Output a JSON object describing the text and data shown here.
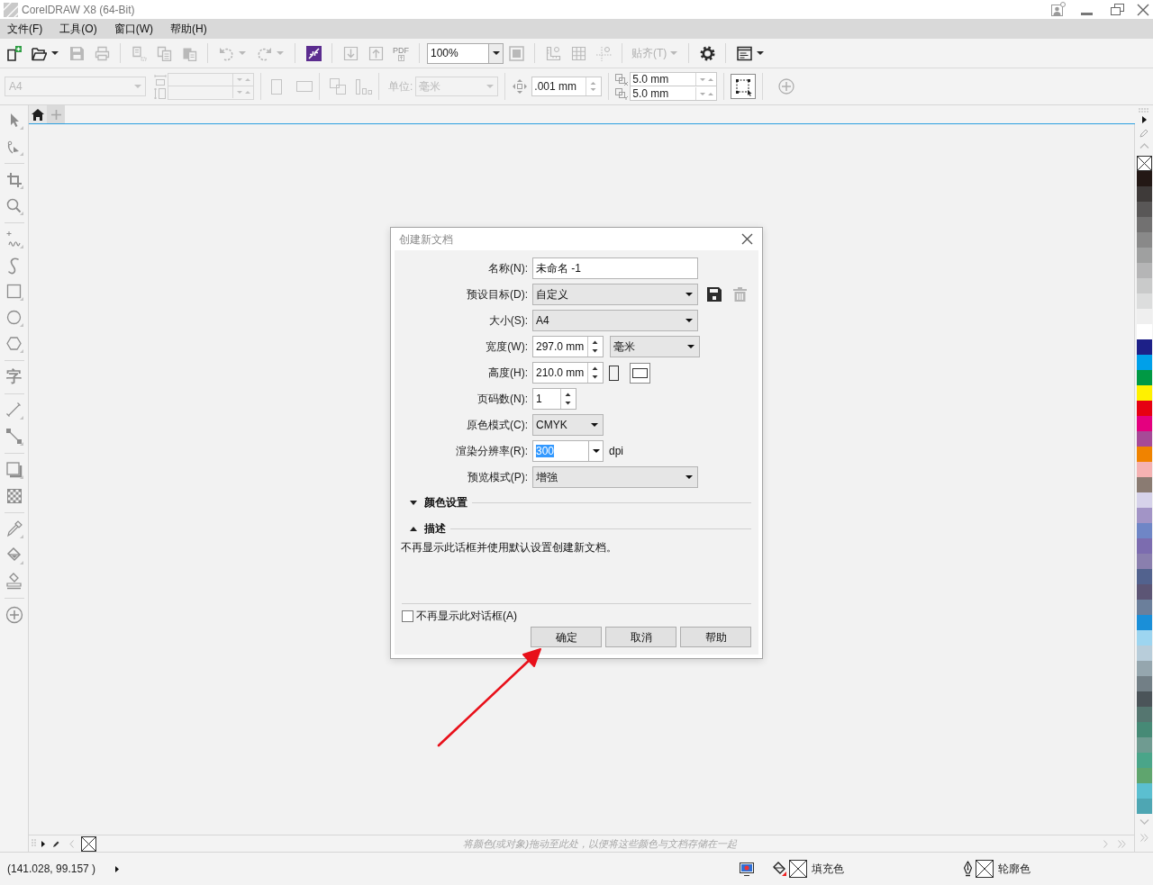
{
  "window": {
    "title": "CorelDRAW X8 (64-Bit)"
  },
  "menu": [
    {
      "label": "文件(F)"
    },
    {
      "label": "工具(O)"
    },
    {
      "label": "窗口(W)"
    },
    {
      "label": "帮助(H)"
    }
  ],
  "toolbar": {
    "groups": [
      [
        {
          "kind": "new",
          "disabled": false
        },
        {
          "kind": "open",
          "disabled": false,
          "dropdown": true
        },
        {
          "kind": "save",
          "disabled": true
        },
        {
          "kind": "print",
          "disabled": true
        }
      ],
      [
        {
          "kind": "cut",
          "disabled": true
        },
        {
          "kind": "copy",
          "disabled": true
        },
        {
          "kind": "paste",
          "disabled": true
        }
      ],
      [
        {
          "kind": "undo",
          "disabled": true,
          "dropdown": true
        },
        {
          "kind": "redo",
          "disabled": true,
          "dropdown": true
        }
      ],
      [
        {
          "kind": "connect",
          "disabled": false
        }
      ],
      [
        {
          "kind": "import",
          "disabled": true
        },
        {
          "kind": "export",
          "disabled": true
        },
        {
          "kind": "pdf",
          "disabled": true,
          "label": "PDF"
        }
      ],
      [
        {
          "kind": "zoom_level",
          "value": "100%"
        },
        {
          "kind": "full_screen",
          "disabled": true
        }
      ],
      [
        {
          "kind": "rulers",
          "disabled": true
        },
        {
          "kind": "grid",
          "disabled": true
        },
        {
          "kind": "guidelines",
          "disabled": true
        }
      ],
      [
        {
          "kind": "snap",
          "label": "贴齐(T)",
          "disabled": true,
          "dropdown": true
        }
      ],
      [
        {
          "kind": "options",
          "disabled": false
        }
      ],
      [
        {
          "kind": "launcher",
          "disabled": false,
          "dropdown": true
        }
      ]
    ]
  },
  "property_bar": {
    "page_size": {
      "value": "A4",
      "disabled": true
    },
    "units": {
      "label": "单位:",
      "value": "毫米",
      "disabled": true
    },
    "nudge": {
      "value": ".001 mm"
    },
    "duplicate_distance": [
      {
        "value": "5.0 mm"
      },
      {
        "value": "5.0 mm"
      }
    ]
  },
  "toolbox": {
    "groups": [
      [
        {
          "kind": "pick"
        },
        {
          "kind": "shape"
        }
      ],
      [
        {
          "kind": "crop"
        },
        {
          "kind": "zoom"
        }
      ],
      [
        {
          "kind": "freehand"
        },
        {
          "kind": "artistic_media"
        },
        {
          "kind": "rectangle"
        },
        {
          "kind": "ellipse"
        },
        {
          "kind": "polygon"
        }
      ],
      [
        {
          "kind": "text",
          "glyph": "字"
        }
      ],
      [
        {
          "kind": "dimension"
        },
        {
          "kind": "connector"
        }
      ],
      [
        {
          "kind": "shadow"
        },
        {
          "kind": "transparency"
        }
      ],
      [
        {
          "kind": "eyedropper"
        },
        {
          "kind": "fill"
        },
        {
          "kind": "smart_fill"
        }
      ],
      [
        {
          "kind": "add"
        }
      ]
    ]
  },
  "document_tabs": [
    {
      "kind": "home",
      "selected": true
    },
    {
      "kind": "add",
      "selected": false
    }
  ],
  "dialog": {
    "title": "创建新文档",
    "fields": [
      {
        "kind": "text",
        "label": "名称(N):",
        "value": "未命名 -1"
      },
      {
        "kind": "dropdown",
        "label": "预设目标(D):",
        "value": "自定义",
        "actions": [
          {
            "kind": "save",
            "disabled": false
          },
          {
            "kind": "delete",
            "disabled": true
          }
        ]
      },
      {
        "kind": "dropdown",
        "label": "大小(S):",
        "value": "A4"
      },
      {
        "kind": "spinner",
        "label": "宽度(W):",
        "value": "297.0 mm",
        "unit": "毫米"
      },
      {
        "kind": "spinner",
        "label": "高度(H):",
        "value": "210.0 mm",
        "orientation": [
          {
            "kind": "portrait",
            "selected": false
          },
          {
            "kind": "landscape",
            "selected": true
          }
        ]
      },
      {
        "kind": "short_spinner",
        "label": "页码数(N):",
        "value": "1"
      },
      {
        "kind": "short_dropdown",
        "label": "原色模式(C):",
        "value": "CMYK"
      },
      {
        "kind": "combo",
        "label": "渲染分辨率(R):",
        "value": "300",
        "text_selected": true,
        "suffix": "dpi"
      },
      {
        "kind": "dropdown",
        "label": "预览模式(P):",
        "value": "增強"
      }
    ],
    "sections": [
      {
        "title": "颜色设置",
        "expanded": false
      },
      {
        "title": "描述",
        "expanded": true,
        "text": "不再显示此话框并使用默认设置创建新文档。"
      }
    ],
    "checkbox": {
      "label": "不再显示此对话框(A)",
      "checked": false
    },
    "buttons": [
      {
        "label": "确定"
      },
      {
        "label": "取消"
      },
      {
        "label": "帮助"
      }
    ]
  },
  "palette": {
    "swatches": [
      {
        "kind": "none"
      },
      {
        "kind": "color",
        "color": "#231815"
      },
      {
        "kind": "color",
        "color": "#3e3a39"
      },
      {
        "kind": "color",
        "color": "#595757"
      },
      {
        "kind": "color",
        "color": "#727171"
      },
      {
        "kind": "color",
        "color": "#898989"
      },
      {
        "kind": "color",
        "color": "#9fa0a0"
      },
      {
        "kind": "color",
        "color": "#b5b5b6"
      },
      {
        "kind": "color",
        "color": "#c9caca"
      },
      {
        "kind": "color",
        "color": "#dcdddd"
      },
      {
        "kind": "color",
        "color": "#efefef"
      },
      {
        "kind": "color",
        "color": "#ffffff"
      },
      {
        "kind": "color",
        "color": "#1d2088"
      },
      {
        "kind": "color",
        "color": "#00a0e9"
      },
      {
        "kind": "color",
        "color": "#009944"
      },
      {
        "kind": "color",
        "color": "#fff100"
      },
      {
        "kind": "color",
        "color": "#e60012"
      },
      {
        "kind": "color",
        "color": "#e4007f"
      },
      {
        "kind": "color",
        "color": "#a64a97"
      },
      {
        "kind": "color",
        "color": "#f08300"
      },
      {
        "kind": "color",
        "color": "#f5b2b2"
      },
      {
        "kind": "color",
        "color": "#8a7b72"
      },
      {
        "kind": "color",
        "color": "#d6d2ea"
      },
      {
        "kind": "color",
        "color": "#a294c6"
      },
      {
        "kind": "color",
        "color": "#6f86c6"
      },
      {
        "kind": "color",
        "color": "#7c6caf"
      },
      {
        "kind": "color",
        "color": "#8a7fae"
      },
      {
        "kind": "color",
        "color": "#52628e"
      },
      {
        "kind": "color",
        "color": "#5c5575"
      },
      {
        "kind": "color",
        "color": "#6b7f9b"
      },
      {
        "kind": "color",
        "color": "#1a8fd8"
      },
      {
        "kind": "color",
        "color": "#9dd5f0"
      },
      {
        "kind": "color",
        "color": "#b8cdda"
      },
      {
        "kind": "color",
        "color": "#95a6ae"
      },
      {
        "kind": "color",
        "color": "#727f86"
      },
      {
        "kind": "color",
        "color": "#4b5459"
      },
      {
        "kind": "color",
        "color": "#557670"
      },
      {
        "kind": "color",
        "color": "#468a76"
      },
      {
        "kind": "color",
        "color": "#6f9b91"
      },
      {
        "kind": "color",
        "color": "#4aa589"
      },
      {
        "kind": "color",
        "color": "#5fa56e"
      },
      {
        "kind": "color",
        "color": "#5bbfd0"
      },
      {
        "kind": "color",
        "color": "#4ea6b3"
      }
    ]
  },
  "document_palette": {
    "hint": "将颜色(或对象)拖动至此处，以便将这些颜色与文档存储在一起"
  },
  "status_bar": {
    "coordinates": "(141.028, 99.157 )",
    "fill": {
      "label": "填充色",
      "no_color": true
    },
    "outline": {
      "label": "轮廓色",
      "no_color": true
    }
  }
}
